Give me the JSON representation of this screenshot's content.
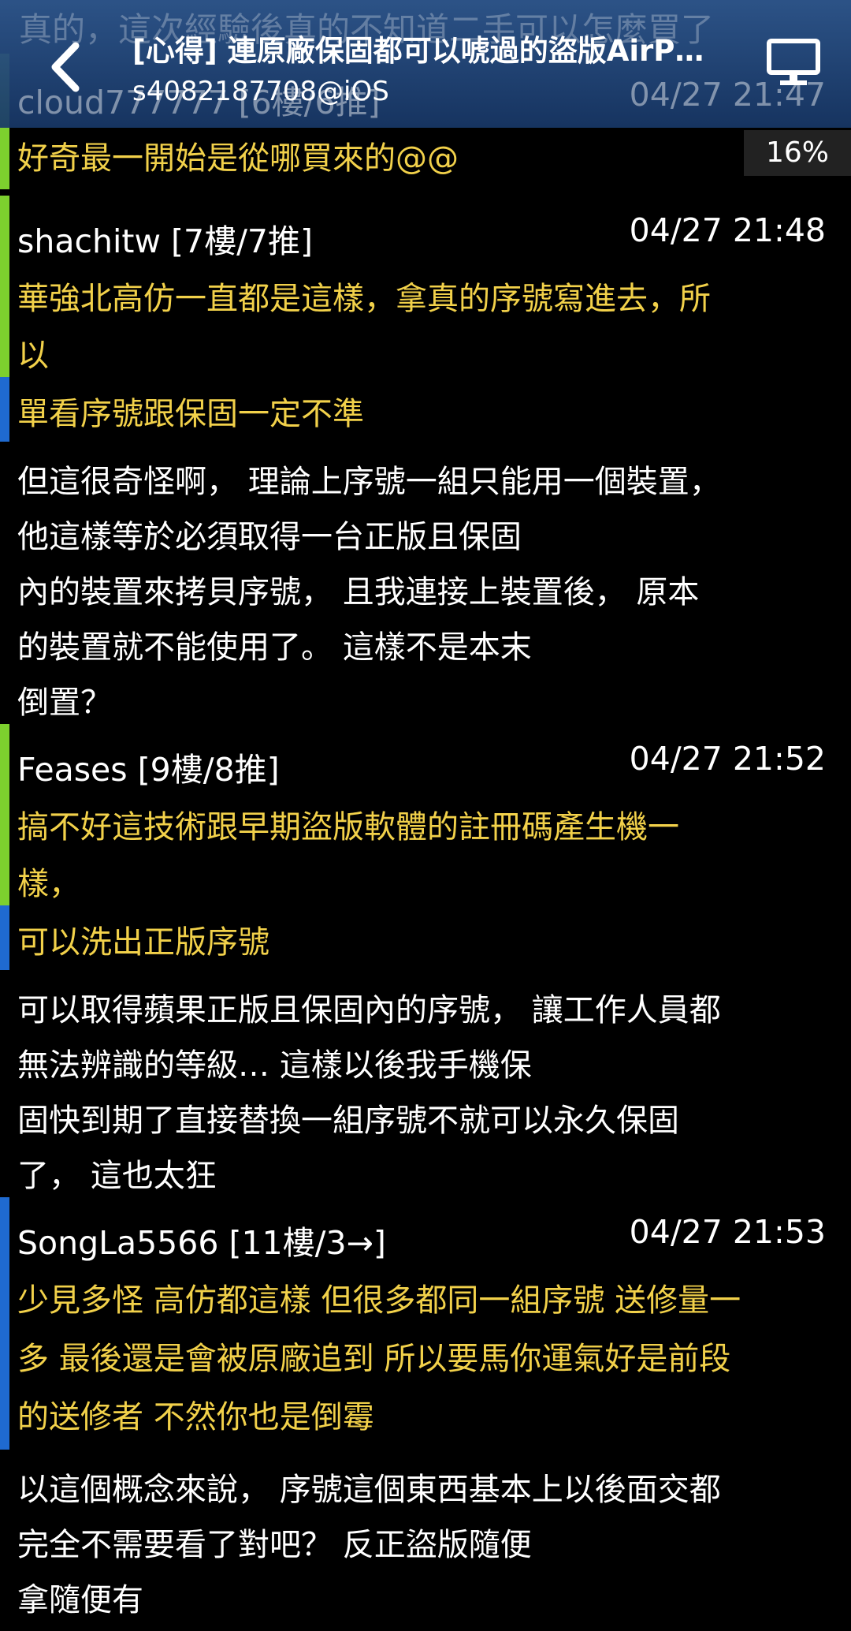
{
  "header": {
    "back_icon": "chevron-left-icon",
    "title": "[心得] 連原廠保固都可以唬過的盜版AirP…",
    "subtitle": "s4082187708@iOS",
    "monitor_icon": "monitor-icon",
    "ghost_text": "真的，這次經驗後真的不知道二手可以怎麼買了"
  },
  "reading_percent": "16%",
  "comments": [
    {
      "author": "cloud777777 [6樓/6推]",
      "time": "04/27 21:47",
      "push_text": [
        "好奇最一開始是從哪買來的@@"
      ],
      "reply_text": []
    },
    {
      "author": "shachitw [7樓/7推]",
      "time": "04/27 21:48",
      "push_text": [
        "華強北高仿一直都是這樣，拿真的序號寫進去，所",
        "以",
        "單看序號跟保固一定不準"
      ],
      "reply_text": [
        "但這很奇怪啊， 理論上序號一組只能用一個裝置，",
        "他這樣等於必須取得一台正版且保固",
        "內的裝置來拷貝序號， 且我連接上裝置後， 原本",
        "的裝置就不能使用了。 這樣不是本末",
        "倒置？"
      ]
    },
    {
      "author": "Feases [9樓/8推]",
      "time": "04/27 21:52",
      "push_text": [
        "搞不好這技術跟早期盜版軟體的註冊碼產生機一",
        "樣，",
        "可以洗出正版序號"
      ],
      "reply_text": [
        "可以取得蘋果正版且保固內的序號， 讓工作人員都",
        "無法辨識的等級… 這樣以後我手機保",
        "固快到期了直接替換一組序號不就可以永久保固",
        "了，  這也太狂"
      ]
    },
    {
      "author": "SongLa5566 [11樓/3→]",
      "time": "04/27 21:53",
      "push_text": [
        "少見多怪 高仿都這樣 但很多都同一組序號 送修量一",
        "多 最後還是會被原廠追到 所以要馬你運氣好是前段",
        "的送修者 不然你也是倒霉"
      ],
      "reply_text": [
        "以這個概念來說， 序號這個東西基本上以後面交都",
        "完全不需要看了對吧？ 反正盜版隨便",
        "拿隨便有"
      ]
    }
  ],
  "colors": {
    "header_bg": "#2c558c",
    "push_text": "#f2d14a",
    "bar_green": "#7dd02e",
    "bar_blue": "#1f6ad0",
    "background": "#000000"
  }
}
